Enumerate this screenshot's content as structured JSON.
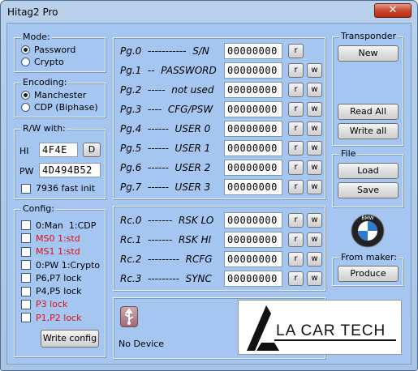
{
  "window": {
    "title": "Hitag2 Pro",
    "close_glyph": "✕"
  },
  "mode": {
    "title": "Mode:",
    "options": [
      {
        "label": "Password",
        "selected": true
      },
      {
        "label": "Crypto",
        "selected": false
      }
    ]
  },
  "encoding": {
    "title": "Encoding:",
    "options": [
      {
        "label": "Manchester",
        "selected": true
      },
      {
        "label": "CDP (Biphase)",
        "selected": false
      }
    ]
  },
  "rw": {
    "title": "R/W with:",
    "hi_label": "HI",
    "hi_value": "4F4E",
    "hi_button": "D",
    "pw_label": "PW",
    "pw_value": "4D494B52",
    "fast_init": "7936 fast init"
  },
  "config": {
    "title": "Config:",
    "items": [
      {
        "label": "0:Man  1:CDP",
        "red": false
      },
      {
        "label": "MS0 1:std",
        "red": true
      },
      {
        "label": "MS1 1:std",
        "red": true
      },
      {
        "label": "0:PW 1:Crypto",
        "red": false
      },
      {
        "label": "P6,P7 lock",
        "red": false
      },
      {
        "label": "P4,P5 lock",
        "red": false
      },
      {
        "label": "P3 lock",
        "red": true
      },
      {
        "label": "P1,P2 lock",
        "red": true
      }
    ],
    "write_button": "Write config"
  },
  "pages": [
    {
      "label": "Pg.0  -----------  S/N",
      "value": "00000000",
      "r": "r",
      "w": ""
    },
    {
      "label": "Pg.1  --  PASSWORD",
      "value": "00000000",
      "r": "r",
      "w": "w"
    },
    {
      "label": "Pg.2  -----  not used",
      "value": "00000000",
      "r": "r",
      "w": "w"
    },
    {
      "label": "Pg.3  ----  CFG/PSW",
      "value": "00000000",
      "r": "r",
      "w": "w"
    },
    {
      "label": "Pg.4  ------  USER 0",
      "value": "00000000",
      "r": "r",
      "w": "w"
    },
    {
      "label": "Pg.5  ------  USER 1",
      "value": "00000000",
      "r": "r",
      "w": "w"
    },
    {
      "label": "Pg.6  ------  USER 2",
      "value": "00000000",
      "r": "r",
      "w": "w"
    },
    {
      "label": "Pg.7  ------  USER 3",
      "value": "00000000",
      "r": "r",
      "w": "w"
    }
  ],
  "rc": [
    {
      "label": "Rc.0  -------  RSK LO",
      "value": "00000000",
      "r": "r",
      "w": "w"
    },
    {
      "label": "Rc.1  -------  RSK HI",
      "value": "00000000",
      "r": "r",
      "w": "w"
    },
    {
      "label": "Rc.2  ---------  RCFG",
      "value": "00000000",
      "r": "r",
      "w": "w"
    },
    {
      "label": "Rc.3  ---------  SYNC",
      "value": "00000000",
      "r": "r",
      "w": "w"
    }
  ],
  "transponder": {
    "title": "Transponder",
    "new": "New",
    "read_all": "Read All",
    "write_all": "Write all"
  },
  "file": {
    "title": "File",
    "load": "Load",
    "save": "Save"
  },
  "maker": {
    "title": "From maker:",
    "produce": "Produce",
    "logo": "BMW"
  },
  "status": {
    "device": "No Device",
    "usb_icon": "usb-icon"
  },
  "brand": {
    "text": "LA CAR TECH"
  }
}
